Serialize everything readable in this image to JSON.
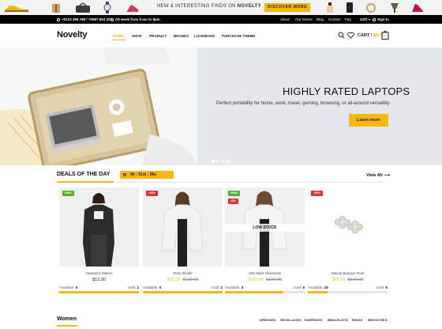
{
  "promo": {
    "text_prefix": "NEW & INTERESTING FINDS ",
    "text_on": "ON",
    "text_brand": " NOVELTY",
    "button": "DISCOVER MORE"
  },
  "topbar": {
    "phone": "+0123 456 789 / +0987 654 321",
    "hours": "All week from 9 am to 9pm",
    "links": [
      "About",
      "Our Stores",
      "Blog",
      "Contact",
      "Faq"
    ],
    "currency": "USD",
    "signin": "Sign In"
  },
  "header": {
    "logo": "Novelty",
    "nav": [
      "HOME",
      "SHOP",
      "PRODUCT",
      "BRANDS",
      "LOOKBOOK",
      "PURCHASE THEME"
    ],
    "cart_label": "CART /",
    "cart_amount": "$0.00"
  },
  "hero": {
    "title": "HIGHLY RATED LAPTOPS",
    "subtitle": "Perfect portability for home, work, travel, gaming, browsing, or all-around versatility",
    "button": "Learn more",
    "slides": 4,
    "active_slide": 1
  },
  "deals": {
    "title": "DEALS OF THE DAY",
    "timer": "9h : 51m : 06s",
    "view_all": "View All",
    "products": [
      {
        "name": "Geometric Pattern",
        "price": "$12.00",
        "old_price": "",
        "badge": "NEW",
        "badge2": "",
        "low_stock": "",
        "available_label": "Available:",
        "available": "0",
        "sold_label": "Sold:",
        "sold": "2",
        "progress": 1.0
      },
      {
        "name": "Party Sheath",
        "price": "$12.00",
        "old_price": "$120.00",
        "badge": "-54%",
        "badge2": "",
        "low_stock": "",
        "available_label": "Available:",
        "available": "0",
        "sold_label": "Sold:",
        "sold": "2",
        "progress": 1.0
      },
      {
        "name": "Slim Waist Sleeveless",
        "price": "$160.00",
        "old_price": "$190.00",
        "badge": "NEW",
        "badge2": "-8%",
        "low_stock": "LOW STOCK",
        "available_label": "Available:",
        "available": "3",
        "sold_label": "Sold:",
        "sold": "8",
        "progress": 0.73
      },
      {
        "name": "Natural Baroque Pearl",
        "price": "$60.00",
        "old_price": "$120.00",
        "badge": "-50%",
        "badge2": "",
        "low_stock": "",
        "available_label": "Available:",
        "available": "15",
        "sold_label": "Sold:",
        "sold": "5",
        "progress": 0.25
      }
    ]
  },
  "women": {
    "title": "Women",
    "tabs": [
      "DRESSES",
      "NECKLACES",
      "EARRINGS",
      "BRACELETS",
      "RINGS",
      "BROOCHES"
    ]
  },
  "colors": {
    "accent": "#f6b70f",
    "new_badge": "#55b12b",
    "sale_badge": "#e03131"
  }
}
